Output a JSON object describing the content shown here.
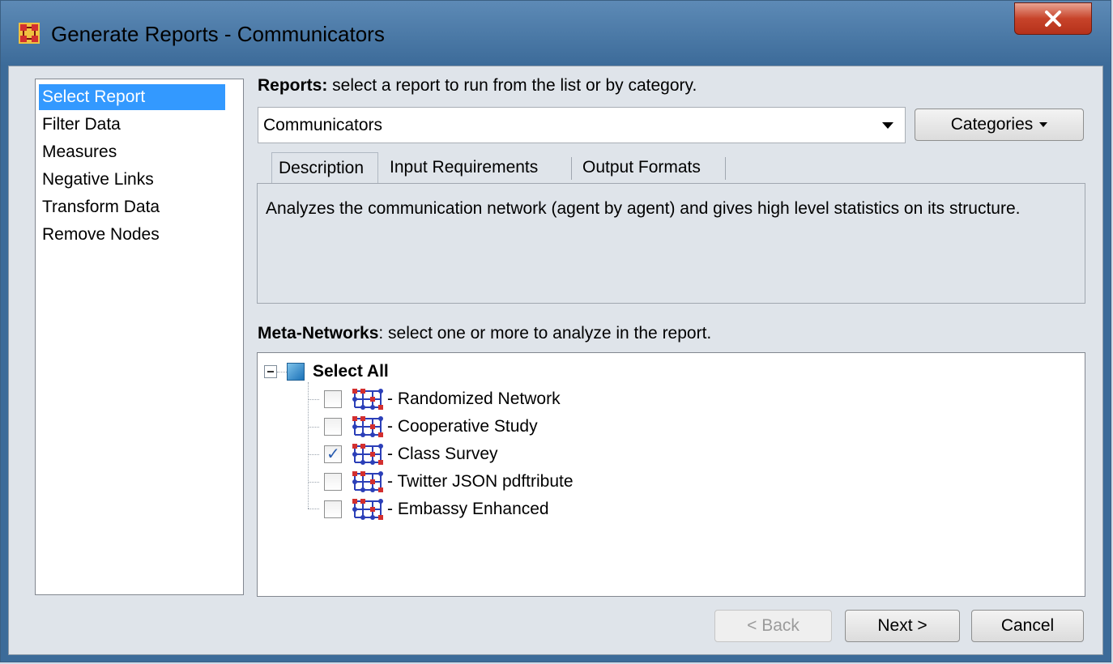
{
  "window": {
    "title": "Generate Reports - Communicators"
  },
  "nav": {
    "items": [
      {
        "label": "Select Report",
        "selected": true
      },
      {
        "label": "Filter Data",
        "selected": false
      },
      {
        "label": "Measures",
        "selected": false
      },
      {
        "label": "Negative Links",
        "selected": false
      },
      {
        "label": "Transform Data",
        "selected": false
      },
      {
        "label": "Remove Nodes",
        "selected": false
      }
    ]
  },
  "reports": {
    "label_bold": "Reports:",
    "label_rest": " select a report to run from the list or by category.",
    "selected_value": "Communicators",
    "categories_label": "Categories"
  },
  "tabs": [
    {
      "label": "Description",
      "active": true
    },
    {
      "label": "Input Requirements",
      "active": false
    },
    {
      "label": "Output Formats",
      "active": false
    }
  ],
  "description": {
    "text": "Analyzes the communication network (agent by agent) and gives high level statistics on its structure."
  },
  "meta_networks": {
    "label_bold": "Meta-Networks",
    "label_rest": ": select one or more to analyze in the report.",
    "select_all_label": "Select All",
    "items": [
      {
        "label": "- Randomized Network",
        "checked": false
      },
      {
        "label": "- Cooperative Study",
        "checked": false
      },
      {
        "label": "- Class Survey",
        "checked": true
      },
      {
        "label": "- Twitter JSON pdftribute",
        "checked": false
      },
      {
        "label": "- Embassy Enhanced",
        "checked": false
      }
    ]
  },
  "buttons": {
    "back_label": "< Back",
    "next_label": "Next >",
    "cancel_label": "Cancel"
  },
  "colors": {
    "selection": "#3399ff",
    "title_bar": "#4a7aa8",
    "close_button": "#c7432a"
  }
}
